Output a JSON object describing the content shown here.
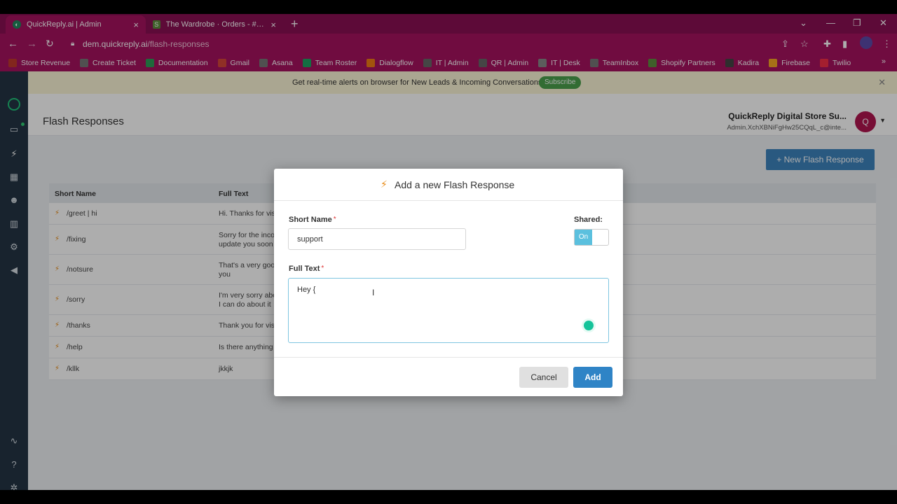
{
  "browser": {
    "tabs": [
      {
        "title": "QuickReply.ai | Admin",
        "close": "×"
      },
      {
        "title": "The Wardrobe · Orders - #1384 · ",
        "close": "×"
      }
    ],
    "new_tab": "+",
    "url_host": "dem.quickreply.ai",
    "url_path": "/flash-responses",
    "bookmarks": [
      {
        "label": "Store Revenue",
        "color": "#c0392b"
      },
      {
        "label": "Create Ticket",
        "color": "#777777"
      },
      {
        "label": "Documentation",
        "color": "#2e9b58"
      },
      {
        "label": "Gmail",
        "color": "#d44638"
      },
      {
        "label": "Asana",
        "color": "#777777"
      },
      {
        "label": "Team Roster",
        "color": "#1ea362"
      },
      {
        "label": "Dialogflow",
        "color": "#ef7b14"
      },
      {
        "label": "IT | Admin",
        "color": "#666666"
      },
      {
        "label": "QR | Admin",
        "color": "#666666"
      },
      {
        "label": "IT | Desk",
        "color": "#888888"
      },
      {
        "label": "TeamInbox",
        "color": "#777777"
      },
      {
        "label": "Shopify Partners",
        "color": "#5e8e3e"
      },
      {
        "label": "Kadira",
        "color": "#444444"
      },
      {
        "label": "Firebase",
        "color": "#f5a623"
      },
      {
        "label": "Twilio",
        "color": "#f22f46"
      }
    ],
    "bookmarks_more": "»"
  },
  "banner": {
    "text": "Get real-time alerts on browser for New Leads & Incoming Conversations",
    "subscribe": "Subscribe"
  },
  "header": {
    "title": "Flash Responses",
    "account_name": "QuickReply Digital Store Su...",
    "account_id": "Admin.XchXBNiFgHw25CQqL_c@inte...",
    "avatar_letter": "Q"
  },
  "new_button": "+ New Flash Response",
  "table": {
    "columns": [
      "Short Name",
      "Full Text"
    ],
    "rows": [
      {
        "short": "/greet | hi",
        "full": [
          "Hi. Thanks for vis"
        ]
      },
      {
        "short": "/fixing",
        "full": [
          "Sorry for the inco",
          "update you soon"
        ]
      },
      {
        "short": "/notsure",
        "full": [
          "That's a very goo",
          "you"
        ]
      },
      {
        "short": "/sorry",
        "full": [
          "I'm very sorry abo",
          "I can do about it"
        ]
      },
      {
        "short": "/thanks",
        "full": [
          "Thank you for visi"
        ]
      },
      {
        "short": "/help",
        "full": [
          "Is there anything"
        ]
      },
      {
        "short": "/kllk",
        "full": [
          "jkkjk"
        ]
      }
    ]
  },
  "modal": {
    "title": "Add a new Flash Response",
    "short_name_label": "Short Name",
    "short_name_value": "support",
    "shared_label": "Shared:",
    "toggle_on": "On",
    "full_text_label": "Full Text",
    "full_text_value": "Hey {",
    "required": "*",
    "cancel": "Cancel",
    "add": "Add"
  }
}
